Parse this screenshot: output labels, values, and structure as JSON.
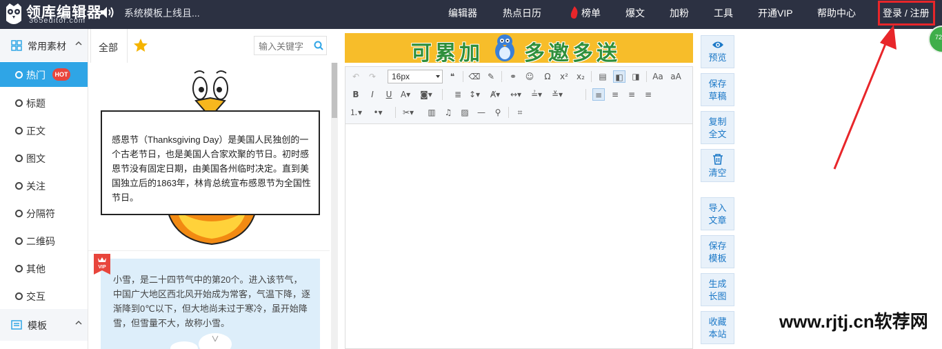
{
  "header": {
    "brand_name": "领库编辑器",
    "brand_domain": "365editor.com",
    "notice": "系统模板上线且...",
    "nav": [
      "编辑器",
      "热点日历",
      "榜单",
      "爆文",
      "加粉",
      "工具",
      "开通VIP",
      "帮助中心"
    ],
    "login": "登录 / 注册",
    "badge": "72"
  },
  "sidebar": {
    "section1": "常用素材",
    "items": [
      "热门",
      "标题",
      "正文",
      "图文",
      "关注",
      "分隔符",
      "二维码",
      "其他",
      "交互"
    ],
    "hot_badge": "HOT",
    "section2": "模板"
  },
  "materials": {
    "tab_all": "全部",
    "search_placeholder": "输入关键字",
    "card1_text": "感恩节（Thanksgiving Day）是美国人民独创的一个古老节日，也是美国人合家欢聚的节日。初时感恩节没有固定日期，由美国各州临时决定。直到美国独立后的1863年，林肯总统宣布感恩节为全国性节日。",
    "card2_text": "小雪，是二十四节气中的第20个。进入该节气，中国广大地区西北风开始成为常客，气温下降，逐渐降到0℃以下，但大地尚未过于寒冷，虽开始降雪，但雪量不大，故称小雪。",
    "vip": "VIP"
  },
  "editor": {
    "banner_left": "可累加",
    "banner_right": "多邀多送",
    "font_size": "16px"
  },
  "actions": [
    {
      "l1": "预览",
      "l2": ""
    },
    {
      "l1": "保存",
      "l2": "草稿"
    },
    {
      "l1": "复制",
      "l2": "全文"
    },
    {
      "l1": "清空",
      "l2": ""
    },
    {
      "l1": "导入",
      "l2": "文章"
    },
    {
      "l1": "保存",
      "l2": "模板"
    },
    {
      "l1": "生成",
      "l2": "长图"
    },
    {
      "l1": "收藏",
      "l2": "本站"
    }
  ],
  "watermark": "www.rjtj.cn软荐网",
  "colors": {
    "topbar": "#2c3142",
    "active": "#2fa5e6",
    "annotation": "#e8262a",
    "hot": "#e8453c"
  }
}
